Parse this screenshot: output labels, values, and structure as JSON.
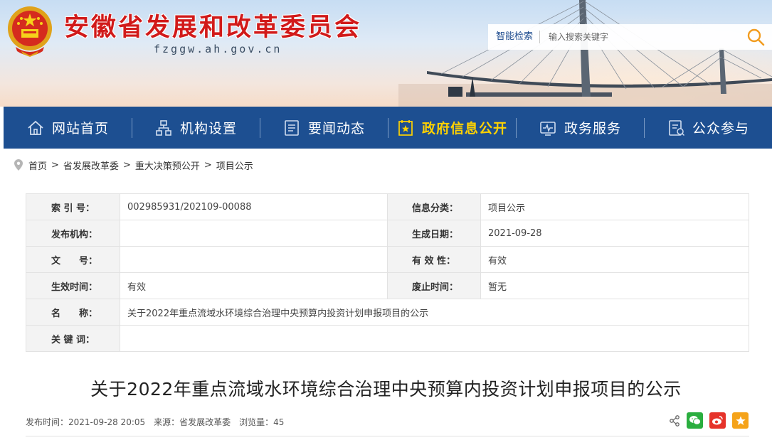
{
  "header": {
    "site_title": "安徽省发展和改革委员会",
    "site_domain": "fzggw.ah.gov.cn",
    "search": {
      "smart_label": "智能检索",
      "placeholder": "输入搜索关键字"
    }
  },
  "nav": {
    "items": [
      {
        "label": "网站首页",
        "icon": "home-icon"
      },
      {
        "label": "机构设置",
        "icon": "org-chart-icon"
      },
      {
        "label": "要闻动态",
        "icon": "news-icon"
      },
      {
        "label": "政府信息公开",
        "icon": "gov-info-icon",
        "active": true
      },
      {
        "label": "政务服务",
        "icon": "service-icon"
      },
      {
        "label": "公众参与",
        "icon": "participation-icon"
      }
    ],
    "active_color": "#ffd200",
    "bar_color": "#1d4f91"
  },
  "breadcrumb": [
    "首页",
    "省发展改革委",
    "重大决策预公开",
    "项目公示"
  ],
  "info": {
    "index_no_label": "索 引 号：",
    "index_no": "002985931/202109-00088",
    "category_label": "信息分类：",
    "category": "项目公示",
    "publisher_label": "发布机构：",
    "publisher": "",
    "created_label": "生成日期：",
    "created": "2021-09-28",
    "doc_no_label": "文　　号：",
    "doc_no": "",
    "validity_label": "有 效 性：",
    "validity": "有效",
    "effective_label": "生效时间：",
    "effective": "有效",
    "abolish_label": "废止时间：",
    "abolish": "暂无",
    "name_label": "名　　称：",
    "name": "关于2022年重点流域水环境综合治理中央预算内投资计划申报项目的公示",
    "keywords_label": "关 键 词：",
    "keywords": ""
  },
  "article": {
    "title": "关于2022年重点流域水环境综合治理中央预算内投资计划申报项目的公示",
    "publish_time": "发布时间：2021-09-28 20:05",
    "source": "来源：省发展改革委",
    "views": "浏览量：45"
  },
  "colors": {
    "title_red": "#d11a1a",
    "wechat": "#2aae3f",
    "weibo": "#e6332a",
    "favorite": "#f5a31a"
  }
}
